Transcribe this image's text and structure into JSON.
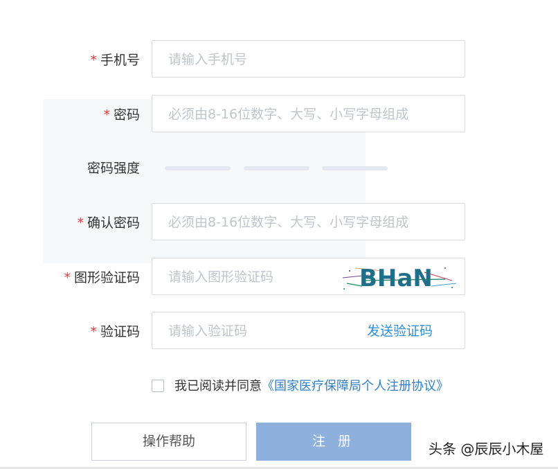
{
  "form": {
    "phone": {
      "required_mark": "*",
      "label": "手机号",
      "placeholder": "请输入手机号"
    },
    "password": {
      "required_mark": "*",
      "label": "密码",
      "placeholder": "必须由8-16位数字、大写、小写字母组成"
    },
    "strength": {
      "label": "密码强度",
      "levels": 3
    },
    "confirm": {
      "required_mark": "*",
      "label": "确认密码",
      "placeholder": "必须由8-16位数字、大写、小写字母组成"
    },
    "captcha": {
      "required_mark": "*",
      "label": "图形验证码",
      "placeholder": "请输入图形验证码",
      "image_text": "BHaN"
    },
    "sms": {
      "required_mark": "*",
      "label": "验证码",
      "placeholder": "请输入验证码",
      "send_label": "发送验证码"
    }
  },
  "agreement": {
    "checked": false,
    "text": "我已阅读并同意",
    "link": "《国家医疗保障局个人注册协议》"
  },
  "buttons": {
    "help": "操作帮助",
    "register": "注 册"
  },
  "watermark": "头条 @辰辰小木屋",
  "colors": {
    "required": "#e4393c",
    "link": "#2f8fd8",
    "register_button": "#8db0dc",
    "strength_bar": "#e3e8f0"
  }
}
